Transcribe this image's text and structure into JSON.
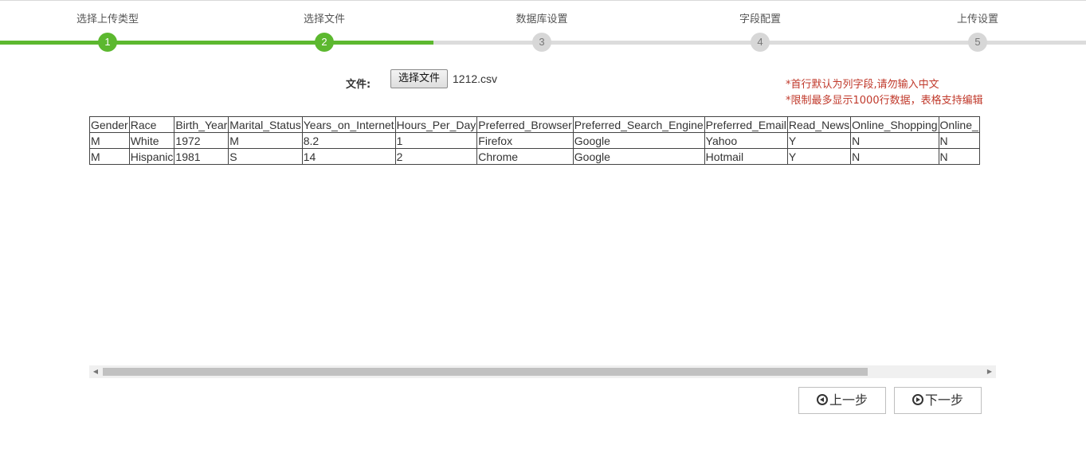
{
  "stepper": {
    "current_step": 2,
    "steps": [
      {
        "number": "1",
        "label": "选择上传类型",
        "status": "done"
      },
      {
        "number": "2",
        "label": "选择文件",
        "status": "done"
      },
      {
        "number": "3",
        "label": "数据库设置",
        "status": "pending"
      },
      {
        "number": "4",
        "label": "字段配置",
        "status": "pending"
      },
      {
        "number": "5",
        "label": "上传设置",
        "status": "pending"
      }
    ],
    "colors": {
      "done": "#5cb82f",
      "pending": "#dcdcdc"
    }
  },
  "file": {
    "label": "文件:",
    "button_label": "选择文件",
    "selected_name": "1212.csv"
  },
  "notes": [
    "*首行默认为列字段,请勿输入中文",
    "*限制最多显示1000行数据，表格支持编辑"
  ],
  "table": {
    "headers": [
      "Gender",
      "Race",
      "Birth_Year",
      "Marital_Status",
      "Years_on_Internet",
      "Hours_Per_Day",
      "Preferred_Browser",
      "Preferred_Search_Engine",
      "Preferred_Email",
      "Read_News",
      "Online_Shopping",
      "Online_"
    ],
    "rows": [
      [
        "M",
        "White",
        "1972",
        "M",
        "8.2",
        "1",
        "Firefox",
        "Google",
        "Yahoo",
        "Y",
        "N",
        "N"
      ],
      [
        "M",
        "Hispanic",
        "1981",
        "S",
        "14",
        "2",
        "Chrome",
        "Google",
        "Hotmail",
        "Y",
        "N",
        "N"
      ]
    ]
  },
  "scrollbar": {
    "position_fraction": 0.0,
    "thumb_fraction": 0.85
  },
  "nav": {
    "prev_label": "上一步",
    "next_label": "下一步",
    "prev_icon": "circle-arrow-left-icon",
    "next_icon": "circle-arrow-right-icon"
  }
}
